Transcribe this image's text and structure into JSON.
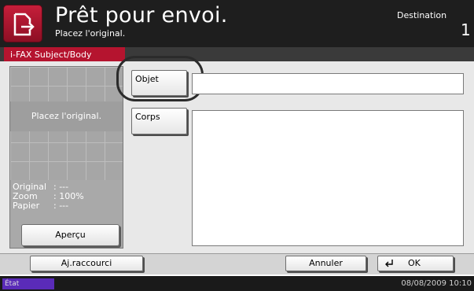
{
  "header": {
    "title": "Prêt pour envoi.",
    "subtitle": "Placez l'original.",
    "destination_label": "Destination",
    "destination_count": "1",
    "icon": "send-document-icon"
  },
  "section": {
    "tab_label": "i-FAX Subject/Body"
  },
  "preview": {
    "message": "Placez l'original.",
    "info": [
      {
        "label": "Original",
        "value": ": ---"
      },
      {
        "label": "Zoom",
        "value": ": 100%"
      },
      {
        "label": "Papier",
        "value": ": ---"
      }
    ],
    "button_label": "Aperçu"
  },
  "fields": {
    "objet_button": "Objet",
    "objet_value": "",
    "corps_button": "Corps",
    "corps_value": ""
  },
  "footer": {
    "shortcut_label": "Aj.raccourci",
    "cancel_label": "Annuler",
    "ok_label": "OK"
  },
  "status": {
    "label": "État",
    "datetime": "08/08/2009   10:10"
  },
  "colors": {
    "accent_red": "#b5142f",
    "status_purple": "#5a2bb8",
    "header_bg": "#1e1e1e"
  }
}
